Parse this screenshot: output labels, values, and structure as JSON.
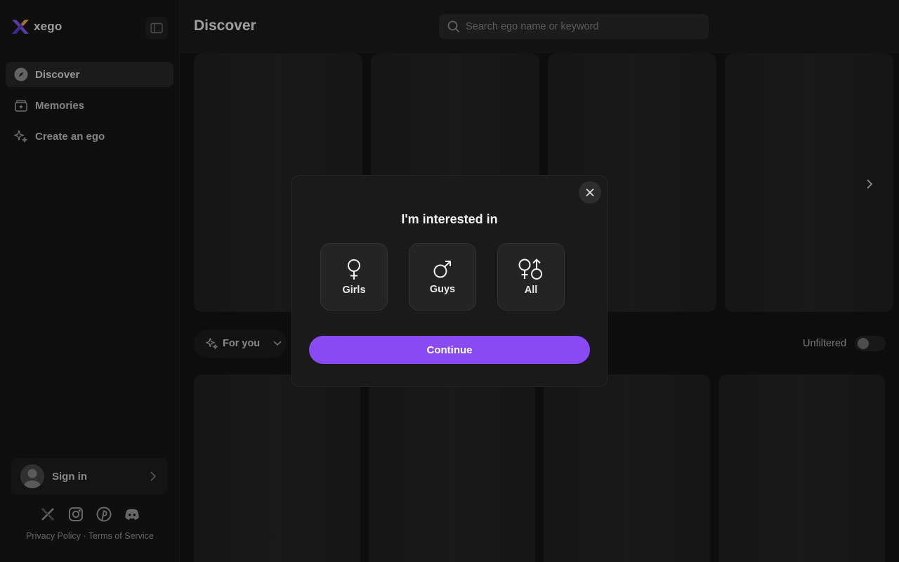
{
  "app": {
    "name": "xego"
  },
  "sidebar": {
    "items": [
      {
        "label": "Discover",
        "icon": "compass-icon",
        "active": true
      },
      {
        "label": "Memories",
        "icon": "memories-icon",
        "active": false
      },
      {
        "label": "Create an ego",
        "icon": "sparkles-icon",
        "active": false
      }
    ],
    "signin_label": "Sign in",
    "socials": [
      "x-icon",
      "instagram-icon",
      "pinterest-icon",
      "discord-icon"
    ],
    "legal": {
      "privacy": "Privacy Policy",
      "separator": "·",
      "terms": "Terms of Service"
    }
  },
  "header": {
    "title": "Discover",
    "search_placeholder": "Search ego name or keyword"
  },
  "main": {
    "filter_label": "For you",
    "unfiltered_label": "Unfiltered",
    "unfiltered_on": false
  },
  "modal": {
    "title": "I'm interested in",
    "options": [
      {
        "label": "Girls",
        "icon": "female-symbol-icon"
      },
      {
        "label": "Guys",
        "icon": "male-symbol-icon"
      },
      {
        "label": "All",
        "icon": "all-genders-icon"
      }
    ],
    "continue_label": "Continue"
  },
  "colors": {
    "accent": "#8a4af3",
    "background": "#141414",
    "sidebar": "#181818"
  }
}
